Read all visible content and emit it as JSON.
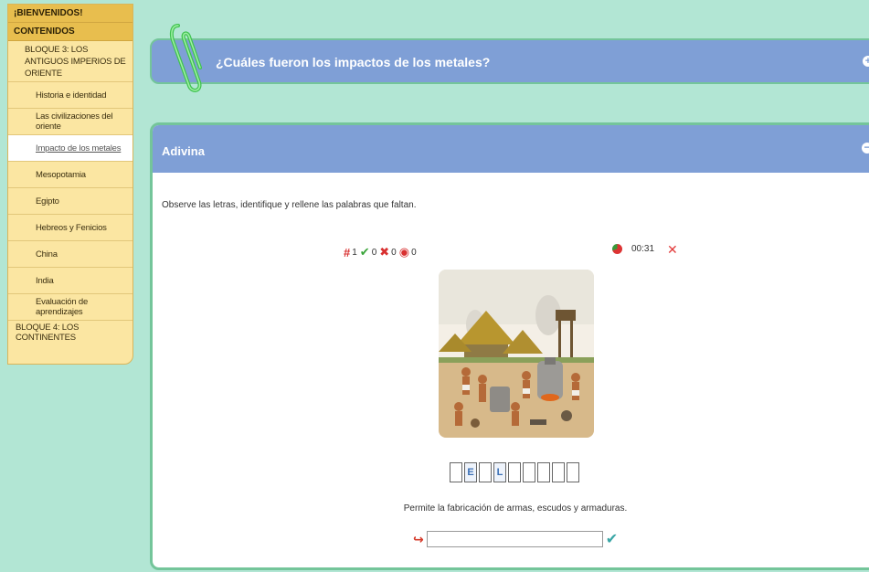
{
  "sidebar": {
    "welcome": "¡BIENVENIDOS!",
    "contents": "CONTENIDOS",
    "bloque3": "BLOQUE 3: LOS ANTIGUOS IMPERIOS DE ORIENTE",
    "items": [
      {
        "label": "Historia e identidad"
      },
      {
        "label": "Las civilizaciones del oriente"
      },
      {
        "label": "Impacto de los metales"
      },
      {
        "label": "Mesopotamia"
      },
      {
        "label": "Egipto"
      },
      {
        "label": "Hebreos y Fenicios"
      },
      {
        "label": "China"
      },
      {
        "label": "India"
      },
      {
        "label": "Evaluación de aprendizajes"
      }
    ],
    "bloque4": "BLOQUE 4: LOS CONTINENTES",
    "active_index": 2
  },
  "header": {
    "question": "¿Cuáles fueron los impactos de los metales?",
    "expand_icon": "+"
  },
  "panel": {
    "title": "Adivina",
    "collapse_icon": "−",
    "instruction": "Observe las letras, identifique y rellene las palabras que faltan.",
    "stats": {
      "attempts": "1",
      "correct": "0",
      "wrong": "0",
      "skipped": "0"
    },
    "timer": "00:31",
    "letters": [
      "",
      "E",
      "",
      "L",
      "",
      "",
      "",
      "",
      ""
    ],
    "hint": "Permite la fabricación de armas, escudos y armaduras.",
    "answer_value": "",
    "colors": {
      "accent_blue": "#7f9fd6",
      "sidebar_bg": "#fbe6a2",
      "page_bg": "#b2e6d4"
    }
  }
}
